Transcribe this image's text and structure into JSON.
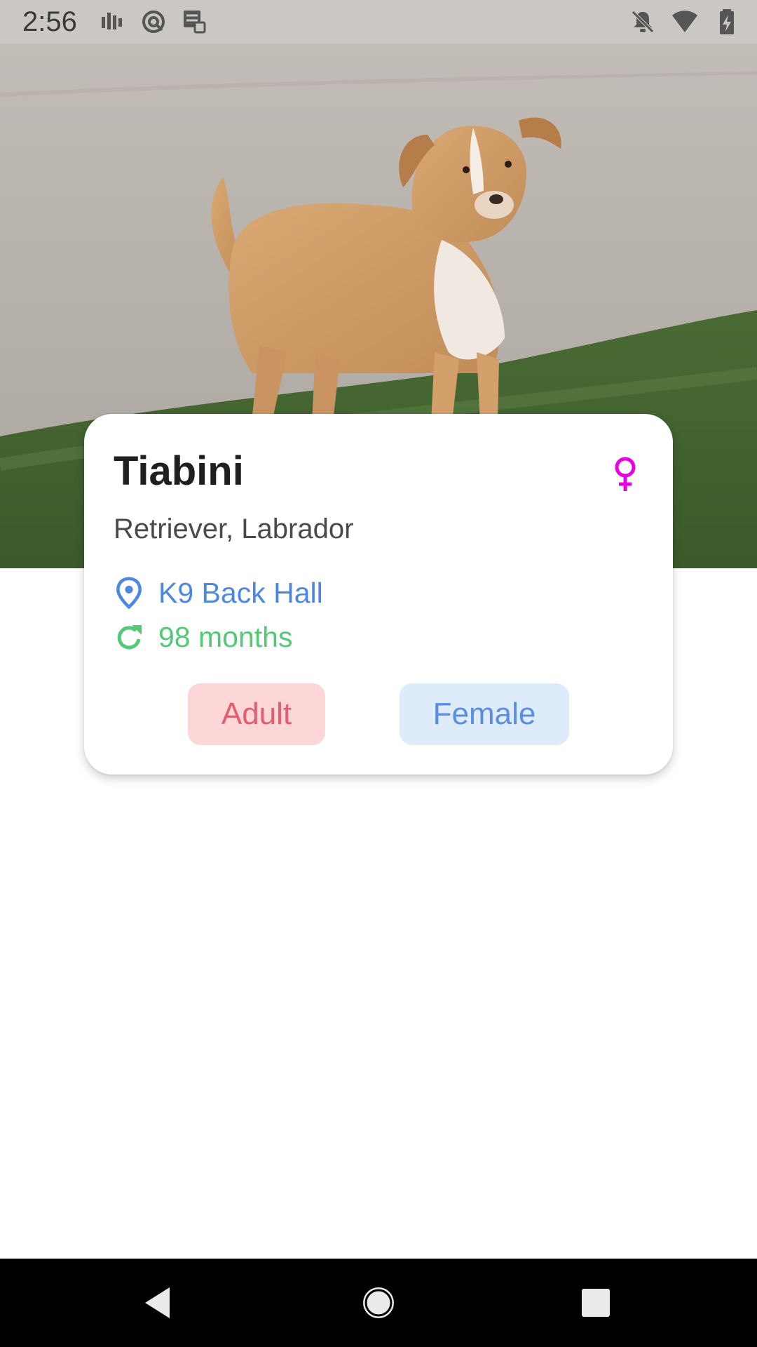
{
  "status_bar": {
    "time": "2:56",
    "left_icons": [
      "signal-bars-icon",
      "sync-icon",
      "storage-icon"
    ],
    "right_icons": [
      "notifications-off-icon",
      "wifi-icon",
      "battery-charging-icon"
    ]
  },
  "hero": {
    "image": "dog-photo"
  },
  "pet": {
    "name": "Tiabini",
    "breed": "Retriever, Labrador",
    "gender_icon": "female-symbol-icon",
    "location_icon": "location-pin-icon",
    "location": "K9 Back Hall",
    "age_icon": "refresh-icon",
    "age": "98 months",
    "chips": {
      "age_group": "Adult",
      "gender": "Female"
    }
  },
  "colors": {
    "gender_symbol": "#e600e6",
    "location": "#4d87e4",
    "age": "#55c778",
    "adult_chip_bg": "#fdd6d7",
    "adult_chip_text": "#e35d6f",
    "female_chip_bg": "#ddebfb",
    "female_chip_text": "#5b8ee2"
  },
  "nav_bar": {
    "buttons": [
      "back-icon",
      "home-icon",
      "recents-icon"
    ]
  }
}
